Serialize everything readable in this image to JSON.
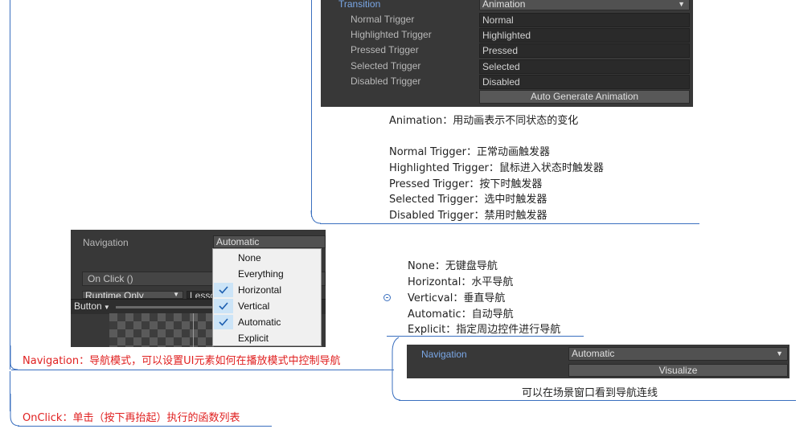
{
  "transition_panel": {
    "transition_label": "Transition",
    "transition_value": "Animation",
    "rows": [
      {
        "label": "Normal Trigger",
        "value": "Normal"
      },
      {
        "label": "Highlighted Trigger",
        "value": "Highlighted"
      },
      {
        "label": "Pressed Trigger",
        "value": "Pressed"
      },
      {
        "label": "Selected Trigger",
        "value": "Selected"
      },
      {
        "label": "Disabled Trigger",
        "value": "Disabled"
      }
    ],
    "auto_generate_label": "Auto Generate Animation"
  },
  "transition_notes": {
    "animation": "Animation：用动画表示不同状态的变化",
    "triggers": [
      "Normal Trigger：正常动画触发器",
      "Highlighted Trigger：鼠标进入状态时触发器",
      "Pressed Trigger：按下时触发器",
      "Selected Trigger：选中时触发器",
      "Disabled Trigger：禁用时触发器"
    ]
  },
  "nav_panel": {
    "navigation_label": "Navigation",
    "navigation_value": "Automatic",
    "onclick_label": "On Click ()",
    "runtime_value": "Runtime Only",
    "partial_field": "Lesso",
    "button_tab": "Button",
    "menu_items": [
      {
        "label": "None",
        "checked": false
      },
      {
        "label": "Everything",
        "checked": false
      },
      {
        "label": "Horizontal",
        "checked": true
      },
      {
        "label": "Vertical",
        "checked": true
      },
      {
        "label": "Automatic",
        "checked": true
      },
      {
        "label": "Explicit",
        "checked": false
      }
    ]
  },
  "nav_notes": [
    "None：无键盘导航",
    "Horizontal：水平导航",
    "Verticval：垂直导航",
    "Automatic：自动导航",
    "Explicit：指定周边控件进行导航"
  ],
  "visualize_panel": {
    "navigation_label": "Navigation",
    "navigation_value": "Automatic",
    "visualize_label": "Visualize",
    "caption": "可以在场景窗口看到导航连线"
  },
  "topics": {
    "navigation": "Navigation：导航模式，可以设置UI元素如何在播放模式中控制导航",
    "onclick": "OnClick：单击（按下再抬起）执行的函数列表"
  },
  "colors": {
    "accent_line": "#3a6fbf",
    "topic_red": "#e02020",
    "unity_bg": "#383838",
    "menu_check_bg": "#cce4f7"
  }
}
